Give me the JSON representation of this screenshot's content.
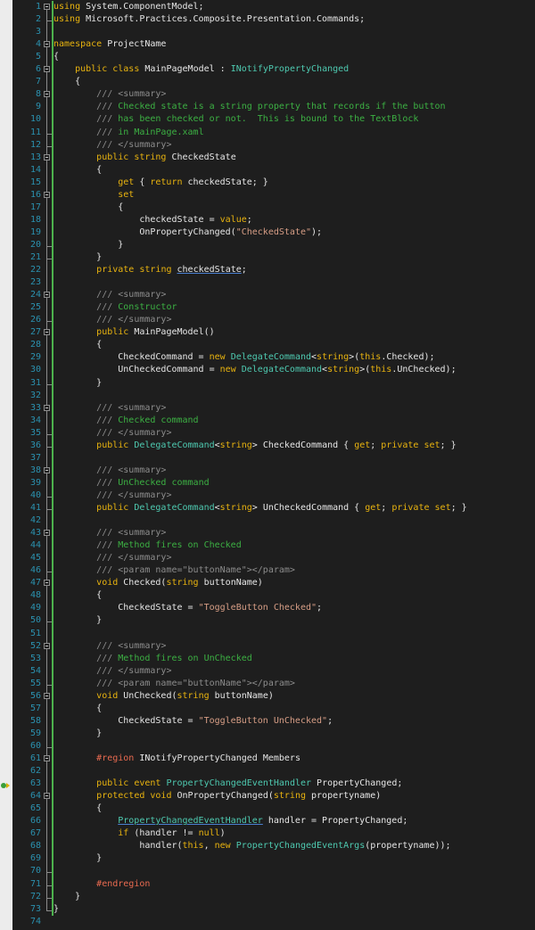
{
  "editor": {
    "lines": [
      [
        {
          "t": "using",
          "c": "kw"
        },
        {
          "t": " System.ComponentModel;"
        }
      ],
      [
        {
          "t": "using",
          "c": "kw"
        },
        {
          "t": " Microsoft.Practices.Composite.Presentation.Commands;"
        }
      ],
      [],
      [
        {
          "t": "namespace",
          "c": "kw"
        },
        {
          "t": " ProjectName"
        }
      ],
      [
        {
          "t": "{"
        }
      ],
      [
        {
          "t": "    "
        },
        {
          "t": "public",
          "c": "kw"
        },
        {
          "t": " "
        },
        {
          "t": "class",
          "c": "kw"
        },
        {
          "t": " MainPageModel : "
        },
        {
          "t": "INotifyPropertyChanged",
          "c": "type"
        }
      ],
      [
        {
          "t": "    {"
        }
      ],
      [
        {
          "t": "        "
        },
        {
          "t": "///",
          "c": "doc"
        },
        {
          "t": " <summary>",
          "c": "doc"
        }
      ],
      [
        {
          "t": "        "
        },
        {
          "t": "///",
          "c": "doc"
        },
        {
          "t": " Checked state is a string property that records if the button",
          "c": "cmt"
        }
      ],
      [
        {
          "t": "        "
        },
        {
          "t": "///",
          "c": "doc"
        },
        {
          "t": " has been checked or not.  This is bound to the TextBlock",
          "c": "cmt"
        }
      ],
      [
        {
          "t": "        "
        },
        {
          "t": "///",
          "c": "doc"
        },
        {
          "t": " in MainPage.xaml",
          "c": "cmt"
        }
      ],
      [
        {
          "t": "        "
        },
        {
          "t": "///",
          "c": "doc"
        },
        {
          "t": " </summary>",
          "c": "doc"
        }
      ],
      [
        {
          "t": "        "
        },
        {
          "t": "public",
          "c": "kw"
        },
        {
          "t": " "
        },
        {
          "t": "string",
          "c": "kw"
        },
        {
          "t": " CheckedState"
        }
      ],
      [
        {
          "t": "        {"
        }
      ],
      [
        {
          "t": "            "
        },
        {
          "t": "get",
          "c": "kw"
        },
        {
          "t": " { "
        },
        {
          "t": "return",
          "c": "kw"
        },
        {
          "t": " checkedState; }"
        }
      ],
      [
        {
          "t": "            "
        },
        {
          "t": "set",
          "c": "kw"
        }
      ],
      [
        {
          "t": "            {"
        }
      ],
      [
        {
          "t": "                checkedState = "
        },
        {
          "t": "value",
          "c": "kw"
        },
        {
          "t": ";"
        }
      ],
      [
        {
          "t": "                OnPropertyChanged("
        },
        {
          "t": "\"CheckedState\"",
          "c": "str"
        },
        {
          "t": ");"
        }
      ],
      [
        {
          "t": "            }"
        }
      ],
      [
        {
          "t": "        }"
        }
      ],
      [
        {
          "t": "        "
        },
        {
          "t": "private",
          "c": "kw"
        },
        {
          "t": " "
        },
        {
          "t": "string",
          "c": "kw"
        },
        {
          "t": " "
        },
        {
          "t": "checkedState",
          "c": "fld"
        },
        {
          "t": ";"
        }
      ],
      [],
      [
        {
          "t": "        "
        },
        {
          "t": "///",
          "c": "doc"
        },
        {
          "t": " <summary>",
          "c": "doc"
        }
      ],
      [
        {
          "t": "        "
        },
        {
          "t": "///",
          "c": "doc"
        },
        {
          "t": " Constructor",
          "c": "cmt"
        }
      ],
      [
        {
          "t": "        "
        },
        {
          "t": "///",
          "c": "doc"
        },
        {
          "t": " </summary>",
          "c": "doc"
        }
      ],
      [
        {
          "t": "        "
        },
        {
          "t": "public",
          "c": "kw"
        },
        {
          "t": " MainPageModel()"
        }
      ],
      [
        {
          "t": "        {"
        }
      ],
      [
        {
          "t": "            CheckedCommand = "
        },
        {
          "t": "new",
          "c": "kw"
        },
        {
          "t": " "
        },
        {
          "t": "DelegateCommand",
          "c": "type"
        },
        {
          "t": "<"
        },
        {
          "t": "string",
          "c": "kw"
        },
        {
          "t": ">("
        },
        {
          "t": "this",
          "c": "kw"
        },
        {
          "t": ".Checked);"
        }
      ],
      [
        {
          "t": "            UnCheckedCommand = "
        },
        {
          "t": "new",
          "c": "kw"
        },
        {
          "t": " "
        },
        {
          "t": "DelegateCommand",
          "c": "type"
        },
        {
          "t": "<"
        },
        {
          "t": "string",
          "c": "kw"
        },
        {
          "t": ">("
        },
        {
          "t": "this",
          "c": "kw"
        },
        {
          "t": ".UnChecked);"
        }
      ],
      [
        {
          "t": "        }"
        }
      ],
      [],
      [
        {
          "t": "        "
        },
        {
          "t": "///",
          "c": "doc"
        },
        {
          "t": " <summary>",
          "c": "doc"
        }
      ],
      [
        {
          "t": "        "
        },
        {
          "t": "///",
          "c": "doc"
        },
        {
          "t": " Checked command",
          "c": "cmt"
        }
      ],
      [
        {
          "t": "        "
        },
        {
          "t": "///",
          "c": "doc"
        },
        {
          "t": " </summary>",
          "c": "doc"
        }
      ],
      [
        {
          "t": "        "
        },
        {
          "t": "public",
          "c": "kw"
        },
        {
          "t": " "
        },
        {
          "t": "DelegateCommand",
          "c": "type"
        },
        {
          "t": "<"
        },
        {
          "t": "string",
          "c": "kw"
        },
        {
          "t": "> CheckedCommand { "
        },
        {
          "t": "get",
          "c": "kw"
        },
        {
          "t": "; "
        },
        {
          "t": "private",
          "c": "kw"
        },
        {
          "t": " "
        },
        {
          "t": "set",
          "c": "kw"
        },
        {
          "t": "; }"
        }
      ],
      [],
      [
        {
          "t": "        "
        },
        {
          "t": "///",
          "c": "doc"
        },
        {
          "t": " <summary>",
          "c": "doc"
        }
      ],
      [
        {
          "t": "        "
        },
        {
          "t": "///",
          "c": "doc"
        },
        {
          "t": " UnChecked command",
          "c": "cmt"
        }
      ],
      [
        {
          "t": "        "
        },
        {
          "t": "///",
          "c": "doc"
        },
        {
          "t": " </summary>",
          "c": "doc"
        }
      ],
      [
        {
          "t": "        "
        },
        {
          "t": "public",
          "c": "kw"
        },
        {
          "t": " "
        },
        {
          "t": "DelegateCommand",
          "c": "type"
        },
        {
          "t": "<"
        },
        {
          "t": "string",
          "c": "kw"
        },
        {
          "t": "> UnCheckedCommand { "
        },
        {
          "t": "get",
          "c": "kw"
        },
        {
          "t": "; "
        },
        {
          "t": "private",
          "c": "kw"
        },
        {
          "t": " "
        },
        {
          "t": "set",
          "c": "kw"
        },
        {
          "t": "; }"
        }
      ],
      [],
      [
        {
          "t": "        "
        },
        {
          "t": "///",
          "c": "doc"
        },
        {
          "t": " <summary>",
          "c": "doc"
        }
      ],
      [
        {
          "t": "        "
        },
        {
          "t": "///",
          "c": "doc"
        },
        {
          "t": " Method fires on Checked",
          "c": "cmt"
        }
      ],
      [
        {
          "t": "        "
        },
        {
          "t": "///",
          "c": "doc"
        },
        {
          "t": " </summary>",
          "c": "doc"
        }
      ],
      [
        {
          "t": "        "
        },
        {
          "t": "///",
          "c": "doc"
        },
        {
          "t": " <param name=\"buttonName\"></param>",
          "c": "doc"
        }
      ],
      [
        {
          "t": "        "
        },
        {
          "t": "void",
          "c": "kw"
        },
        {
          "t": " Checked("
        },
        {
          "t": "string",
          "c": "kw"
        },
        {
          "t": " buttonName)"
        }
      ],
      [
        {
          "t": "        {"
        }
      ],
      [
        {
          "t": "            CheckedState = "
        },
        {
          "t": "\"ToggleButton Checked\"",
          "c": "str"
        },
        {
          "t": ";"
        }
      ],
      [
        {
          "t": "        }"
        }
      ],
      [],
      [
        {
          "t": "        "
        },
        {
          "t": "///",
          "c": "doc"
        },
        {
          "t": " <summary>",
          "c": "doc"
        }
      ],
      [
        {
          "t": "        "
        },
        {
          "t": "///",
          "c": "doc"
        },
        {
          "t": " Method fires on UnChecked",
          "c": "cmt"
        }
      ],
      [
        {
          "t": "        "
        },
        {
          "t": "///",
          "c": "doc"
        },
        {
          "t": " </summary>",
          "c": "doc"
        }
      ],
      [
        {
          "t": "        "
        },
        {
          "t": "///",
          "c": "doc"
        },
        {
          "t": " <param name=\"buttonName\"></param>",
          "c": "doc"
        }
      ],
      [
        {
          "t": "        "
        },
        {
          "t": "void",
          "c": "kw"
        },
        {
          "t": " UnChecked("
        },
        {
          "t": "string",
          "c": "kw"
        },
        {
          "t": " buttonName)"
        }
      ],
      [
        {
          "t": "        {"
        }
      ],
      [
        {
          "t": "            CheckedState = "
        },
        {
          "t": "\"ToggleButton UnChecked\"",
          "c": "str"
        },
        {
          "t": ";"
        }
      ],
      [
        {
          "t": "        }"
        }
      ],
      [],
      [
        {
          "t": "        "
        },
        {
          "t": "#region",
          "c": "rgn"
        },
        {
          "t": " INotifyPropertyChanged Members"
        }
      ],
      [],
      [
        {
          "t": "        "
        },
        {
          "t": "public",
          "c": "kw"
        },
        {
          "t": " "
        },
        {
          "t": "event",
          "c": "kw"
        },
        {
          "t": " "
        },
        {
          "t": "PropertyChangedEventHandler",
          "c": "type"
        },
        {
          "t": " PropertyChanged;"
        }
      ],
      [
        {
          "t": "        "
        },
        {
          "t": "protected",
          "c": "kw"
        },
        {
          "t": " "
        },
        {
          "t": "void",
          "c": "kw"
        },
        {
          "t": " OnPropertyChanged("
        },
        {
          "t": "string",
          "c": "kw"
        },
        {
          "t": " propertyname)"
        }
      ],
      [
        {
          "t": "        {"
        }
      ],
      [
        {
          "t": "            "
        },
        {
          "t": "PropertyChangedEventHandler",
          "c": "type ul"
        },
        {
          "t": " handler = PropertyChanged;"
        }
      ],
      [
        {
          "t": "            "
        },
        {
          "t": "if",
          "c": "kw"
        },
        {
          "t": " (handler != "
        },
        {
          "t": "null",
          "c": "kw"
        },
        {
          "t": ")"
        }
      ],
      [
        {
          "t": "                handler("
        },
        {
          "t": "this",
          "c": "kw"
        },
        {
          "t": ", "
        },
        {
          "t": "new",
          "c": "kw"
        },
        {
          "t": " "
        },
        {
          "t": "PropertyChangedEventArgs",
          "c": "type"
        },
        {
          "t": "(propertyname));"
        }
      ],
      [
        {
          "t": "        }"
        }
      ],
      [],
      [
        {
          "t": "        "
        },
        {
          "t": "#endregion",
          "c": "rgn"
        }
      ],
      [
        {
          "t": "    }"
        }
      ],
      [
        {
          "t": "}"
        }
      ],
      []
    ],
    "fold_starts": [
      1,
      4,
      6,
      8,
      13,
      16,
      24,
      27,
      33,
      38,
      43,
      47,
      52,
      56,
      61,
      64
    ],
    "fold_ends": [
      2,
      11,
      12,
      20,
      21,
      26,
      31,
      35,
      36,
      40,
      41,
      46,
      50,
      55,
      60,
      70,
      71,
      72,
      73
    ],
    "margin_glyph": "event-glyph-icon",
    "margin_glyph_line": 63
  },
  "colors": {
    "background": "#1e1e1e",
    "line_numbers": "#2b91af",
    "keyword": "#e8b30f",
    "type": "#4ec9b0",
    "comment": "#3cb043",
    "doc_tag": "#8c8c8c",
    "string": "#d69d85",
    "region": "#e86a50",
    "change_bar": "#4db24d"
  }
}
